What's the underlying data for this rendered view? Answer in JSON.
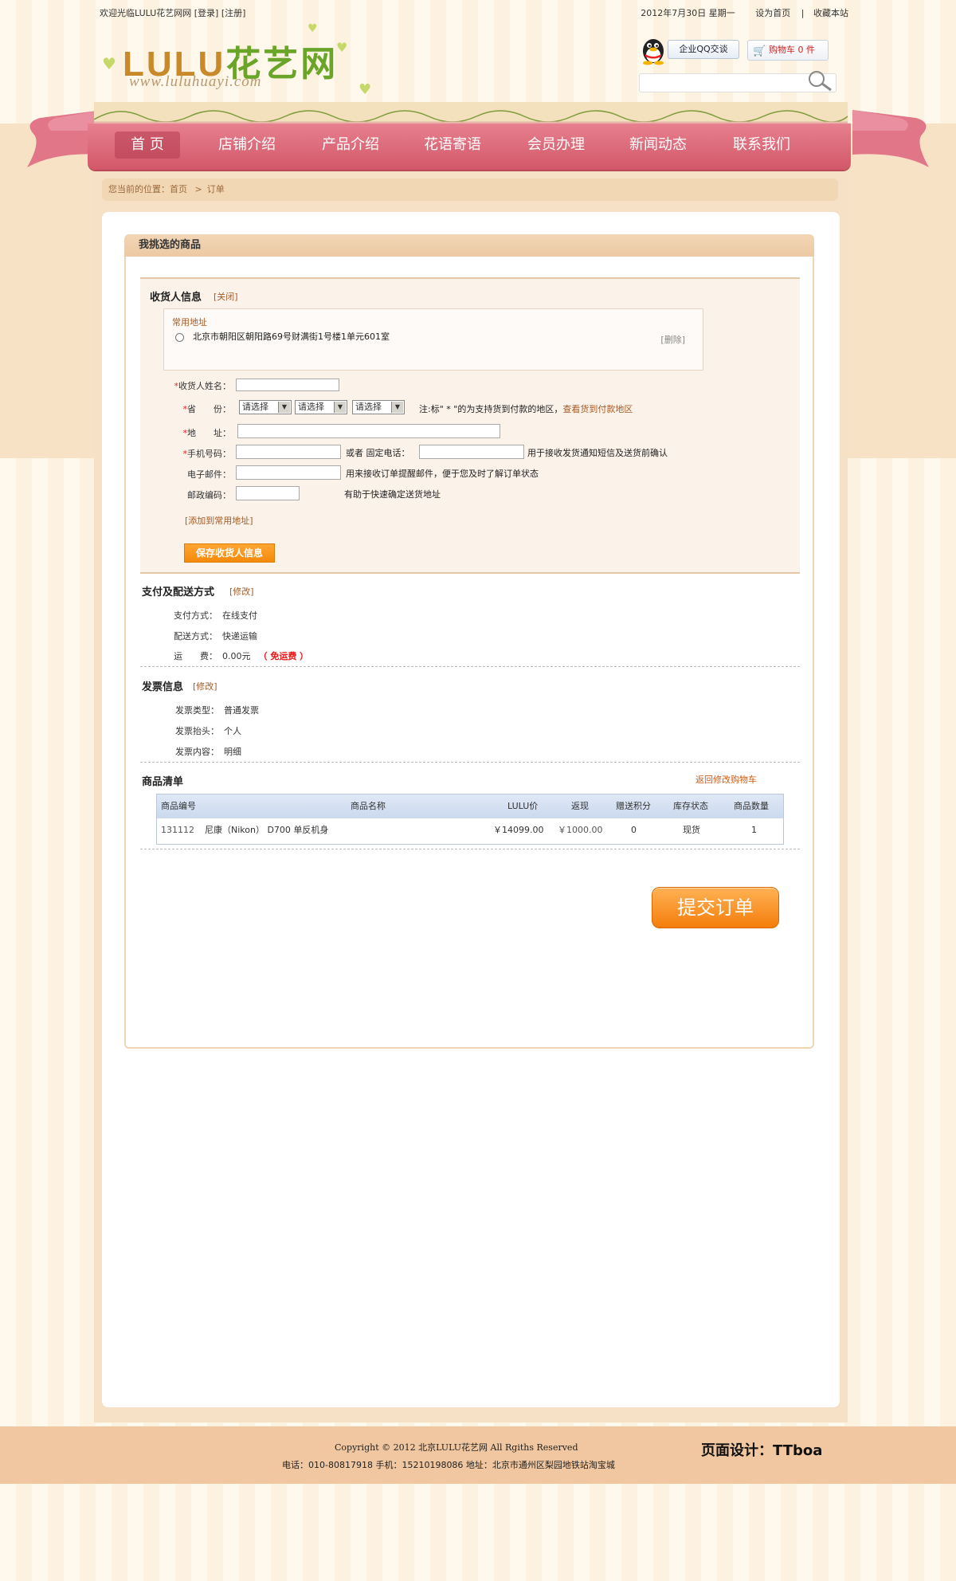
{
  "topbar": {
    "welcome": "欢迎光临LULU花艺网网",
    "login": "[登录]",
    "register": "[注册]",
    "date": "2012年7月30日 星期一",
    "set_home": "设为首页",
    "separator": "|",
    "bookmark": "收藏本站"
  },
  "logo": {
    "brand_latin": "LULU",
    "brand_cn": "花艺网",
    "url": "www.luluhuayi.com"
  },
  "header": {
    "qq_label": "企业QQ交谈",
    "cart_label": "购物车 0 件",
    "search_placeholder": ""
  },
  "nav": {
    "items": [
      {
        "label": "首  页",
        "active": true
      },
      {
        "label": "店铺介绍"
      },
      {
        "label": "产品介绍"
      },
      {
        "label": "花语寄语"
      },
      {
        "label": "会员办理"
      },
      {
        "label": "新闻动态"
      },
      {
        "label": "联系我们"
      }
    ]
  },
  "breadcrumb": {
    "prefix": "您当前的位置：",
    "home": "首页",
    "sep": ">",
    "current": "订单"
  },
  "panel": {
    "title": "我挑选的商品"
  },
  "receiver": {
    "title": "收货人信息",
    "close_link": "[关闭]",
    "common_addr_title": "常用地址",
    "common_addr": "北京市朝阳区朝阳路69号财满街1号楼1单元601室",
    "delete_link": "[删除]",
    "name_label": "收货人姓名：",
    "province_label": "省　　份：",
    "select_default": "请选择",
    "province_note": "注:标\" * \"的为支持货到付款的地区，",
    "province_note_link": "查看货到付款地区",
    "address_label": "地　　址：",
    "mobile_label": "手机号码：",
    "or_phone": "或者  固定电话：",
    "phone_note": "用于接收发货通知短信及送货前确认",
    "email_label": "电子邮件：",
    "email_note": "用来接收订单提醒邮件，便于您及时了解订单状态",
    "zip_label": "邮政编码：",
    "zip_note": "有助于快速确定送货地址",
    "add_common": "[添加到常用地址]",
    "save_btn": "保存收货人信息"
  },
  "payment": {
    "title": "支付及配送方式",
    "edit": "[修改]",
    "pay_label": "支付方式：",
    "pay_value": "在线支付",
    "ship_label": "配送方式：",
    "ship_value": "快递运输",
    "fee_label": "运　　费：",
    "fee_value": "0.00元",
    "free": "（ 免运费 ）"
  },
  "invoice": {
    "title": "发票信息",
    "edit": "[修改]",
    "type_label": "发票类型：",
    "type_value": "普通发票",
    "head_label": "发票抬头：",
    "head_value": "个人",
    "content_label": "发票内容：",
    "content_value": "明细"
  },
  "goods": {
    "title": "商品清单",
    "back_link": "返回修改购物车",
    "columns": [
      "商品编号",
      "商品名称",
      "LULU价",
      "返现",
      "赠送积分",
      "库存状态",
      "商品数量"
    ],
    "rows": [
      {
        "id": "131112",
        "name": "尼康（Nikon） D700 单反机身",
        "price": "￥14099.00",
        "cashback": "￥1000.00",
        "points": "0",
        "stock": "现货",
        "qty": "1"
      }
    ]
  },
  "submit_btn": "提交订单",
  "footer": {
    "copyright": "Copyright © 2012 北京LULU花艺网 All Rgiths Reserved",
    "contact": "电话：010-80817918    手机：15210198086    地址：北京市通州区梨园地铁站淘宝城",
    "design": "页面设计：TTboa"
  },
  "colors": {
    "nav_pink": "#d25868",
    "panel_tan": "#ecc9a3",
    "link_brown": "#a65a24",
    "accent_orange": "#f58a0a",
    "table_head_blue": "#cbd9ee"
  }
}
